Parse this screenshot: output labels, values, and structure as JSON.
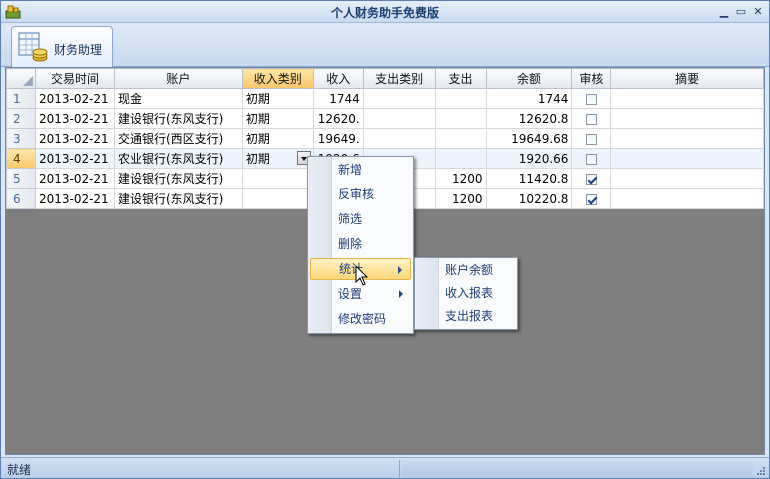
{
  "window": {
    "title": "个人财务助手免费版"
  },
  "ribbon": {
    "tab_label": "财务助理"
  },
  "grid": {
    "columns": [
      "交易时间",
      "账户",
      "收入类别",
      "收入",
      "支出类别",
      "支出",
      "余额",
      "审核",
      "摘要"
    ],
    "rows": [
      {
        "num": "1",
        "date": "2013-02-21",
        "account": "现金",
        "income_type": "初期",
        "income": "1744",
        "expense_type": "",
        "expense": "",
        "balance": "1744",
        "audited": false,
        "memo": ""
      },
      {
        "num": "2",
        "date": "2013-02-21",
        "account": "建设银行(东风支行)",
        "income_type": "初期",
        "income": "12620.",
        "expense_type": "",
        "expense": "",
        "balance": "12620.8",
        "audited": false,
        "memo": ""
      },
      {
        "num": "3",
        "date": "2013-02-21",
        "account": "交通银行(西区支行)",
        "income_type": "初期",
        "income": "19649.",
        "expense_type": "",
        "expense": "",
        "balance": "19649.68",
        "audited": false,
        "memo": ""
      },
      {
        "num": "4",
        "date": "2013-02-21",
        "account": "农业银行(东风支行)",
        "income_type": "初期",
        "income": "1920.6",
        "expense_type": "",
        "expense": "",
        "balance": "1920.66",
        "audited": false,
        "memo": ""
      },
      {
        "num": "5",
        "date": "2013-02-21",
        "account": "建设银行(东风支行)",
        "income_type": "",
        "income": "",
        "expense_type": "",
        "expense": "1200",
        "balance": "11420.8",
        "audited": true,
        "memo": ""
      },
      {
        "num": "6",
        "date": "2013-02-21",
        "account": "建设银行(东风支行)",
        "income_type": "",
        "income": "",
        "expense_type": "",
        "expense": "1200",
        "balance": "10220.8",
        "audited": true,
        "memo": ""
      }
    ]
  },
  "context_menu": {
    "items": [
      "新增",
      "反审核",
      "筛选",
      "删除",
      "统计",
      "设置",
      "修改密码"
    ],
    "highlighted": "统计"
  },
  "submenu": {
    "items": [
      "账户余额",
      "收入报表",
      "支出报表"
    ]
  },
  "status": {
    "text": "就绪"
  },
  "colors": {
    "accent": "#f8c567",
    "titlebar_text": "#1b3f73",
    "menu_text": "#1d3c78",
    "grid_background": "#7f7f7f"
  }
}
